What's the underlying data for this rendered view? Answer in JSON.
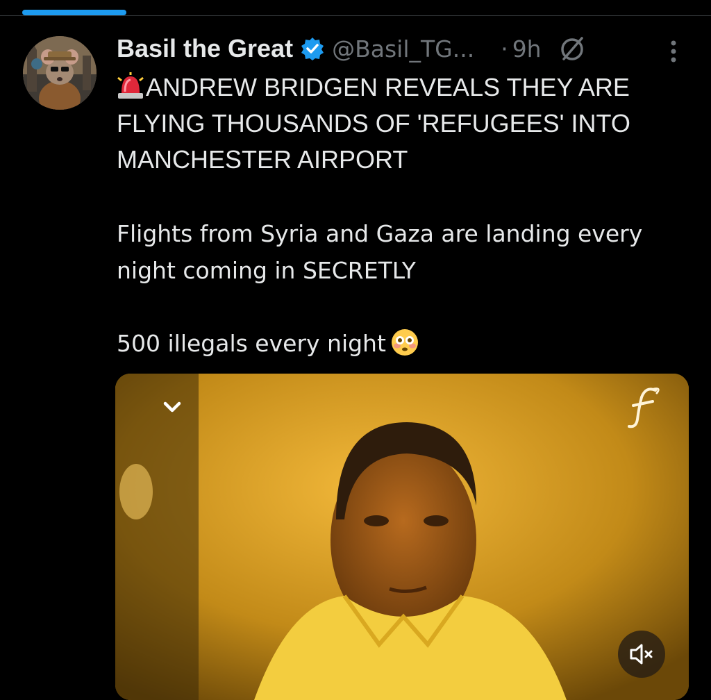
{
  "tweet": {
    "author": {
      "display_name": "Basil the Great",
      "handle": "@Basil_TG...",
      "verified": true
    },
    "separator": "·",
    "timestamp": "9h",
    "headline_lines": [
      "ANDREW BRIDGEN REVEALS THEY ARE",
      "FLYING THOUSANDS OF 'REFUGEES' INTO",
      "MANCHESTER AIRPORT"
    ],
    "paragraph_1_lines": [
      "Flights from Syria and Gaza are landing every",
      "night coming in SECRETLY"
    ],
    "paragraph_2": "500 illegals every night"
  },
  "icons": {
    "headline_prefix": "police-car-light-emoji",
    "paragraph_suffix": "flushed-face-emoji",
    "verified": "verified-badge-icon",
    "audience": "circle-slash-icon",
    "menu": "more-vertical-icon",
    "video_collapse": "chevron-down-icon",
    "video_mute": "speaker-muted-icon"
  },
  "colors": {
    "background": "#000000",
    "text": "#e7e9ea",
    "secondary_text": "#71767b",
    "accent": "#1d9bf0"
  }
}
